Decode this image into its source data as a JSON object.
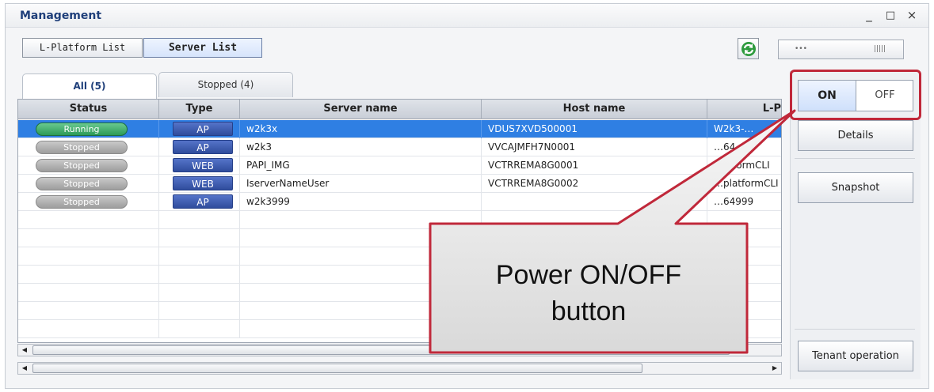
{
  "window": {
    "title": "Management",
    "controls": [
      "_",
      "□",
      "×"
    ]
  },
  "top_tabs": [
    {
      "label": "L-Platform List",
      "selected": false
    },
    {
      "label": "Server List",
      "selected": true
    }
  ],
  "refresh": {
    "icon": "refresh-icon"
  },
  "tabs": [
    {
      "label": "All (5)",
      "active": true
    },
    {
      "label": "Stopped (4)",
      "active": false
    }
  ],
  "columns": [
    "Status",
    "Type",
    "Server name",
    "Host name",
    "L-P"
  ],
  "rows": [
    {
      "status": "Running",
      "type": "AP",
      "server": "w2k3x",
      "host": "VDUS7XVD500001",
      "lp": "W2k3-…",
      "selected": true
    },
    {
      "status": "Stopped",
      "type": "AP",
      "server": "w2k3",
      "host": "VVCAJMFH7N0001",
      "lp": "…64",
      "selected": false
    },
    {
      "status": "Stopped",
      "type": "WEB",
      "server": "PAPI_IMG",
      "host": "VCTRREMA8G0001",
      "lp": "…atformCLI",
      "selected": false
    },
    {
      "status": "Stopped",
      "type": "WEB",
      "server": "IserverNameUser",
      "host": "VCTRREMA8G0002",
      "lp": "…platformCLI",
      "selected": false
    },
    {
      "status": "Stopped",
      "type": "AP",
      "server": "w2k3999",
      "host": "",
      "lp": "…64999",
      "selected": false
    }
  ],
  "power": {
    "on_label": "ON",
    "off_label": "OFF",
    "state": "ON"
  },
  "side_buttons": {
    "details": "Details",
    "snapshot": "Snapshot",
    "tenant": "Tenant operation"
  },
  "callout": {
    "line1": "Power ON/OFF",
    "line2": "button"
  },
  "colors": {
    "accent": "#2f7fe3",
    "running": "#2c9a57",
    "stopped": "#9d9d9d",
    "type_badge": "#2f4c9c",
    "callout_border": "#c0283a"
  }
}
